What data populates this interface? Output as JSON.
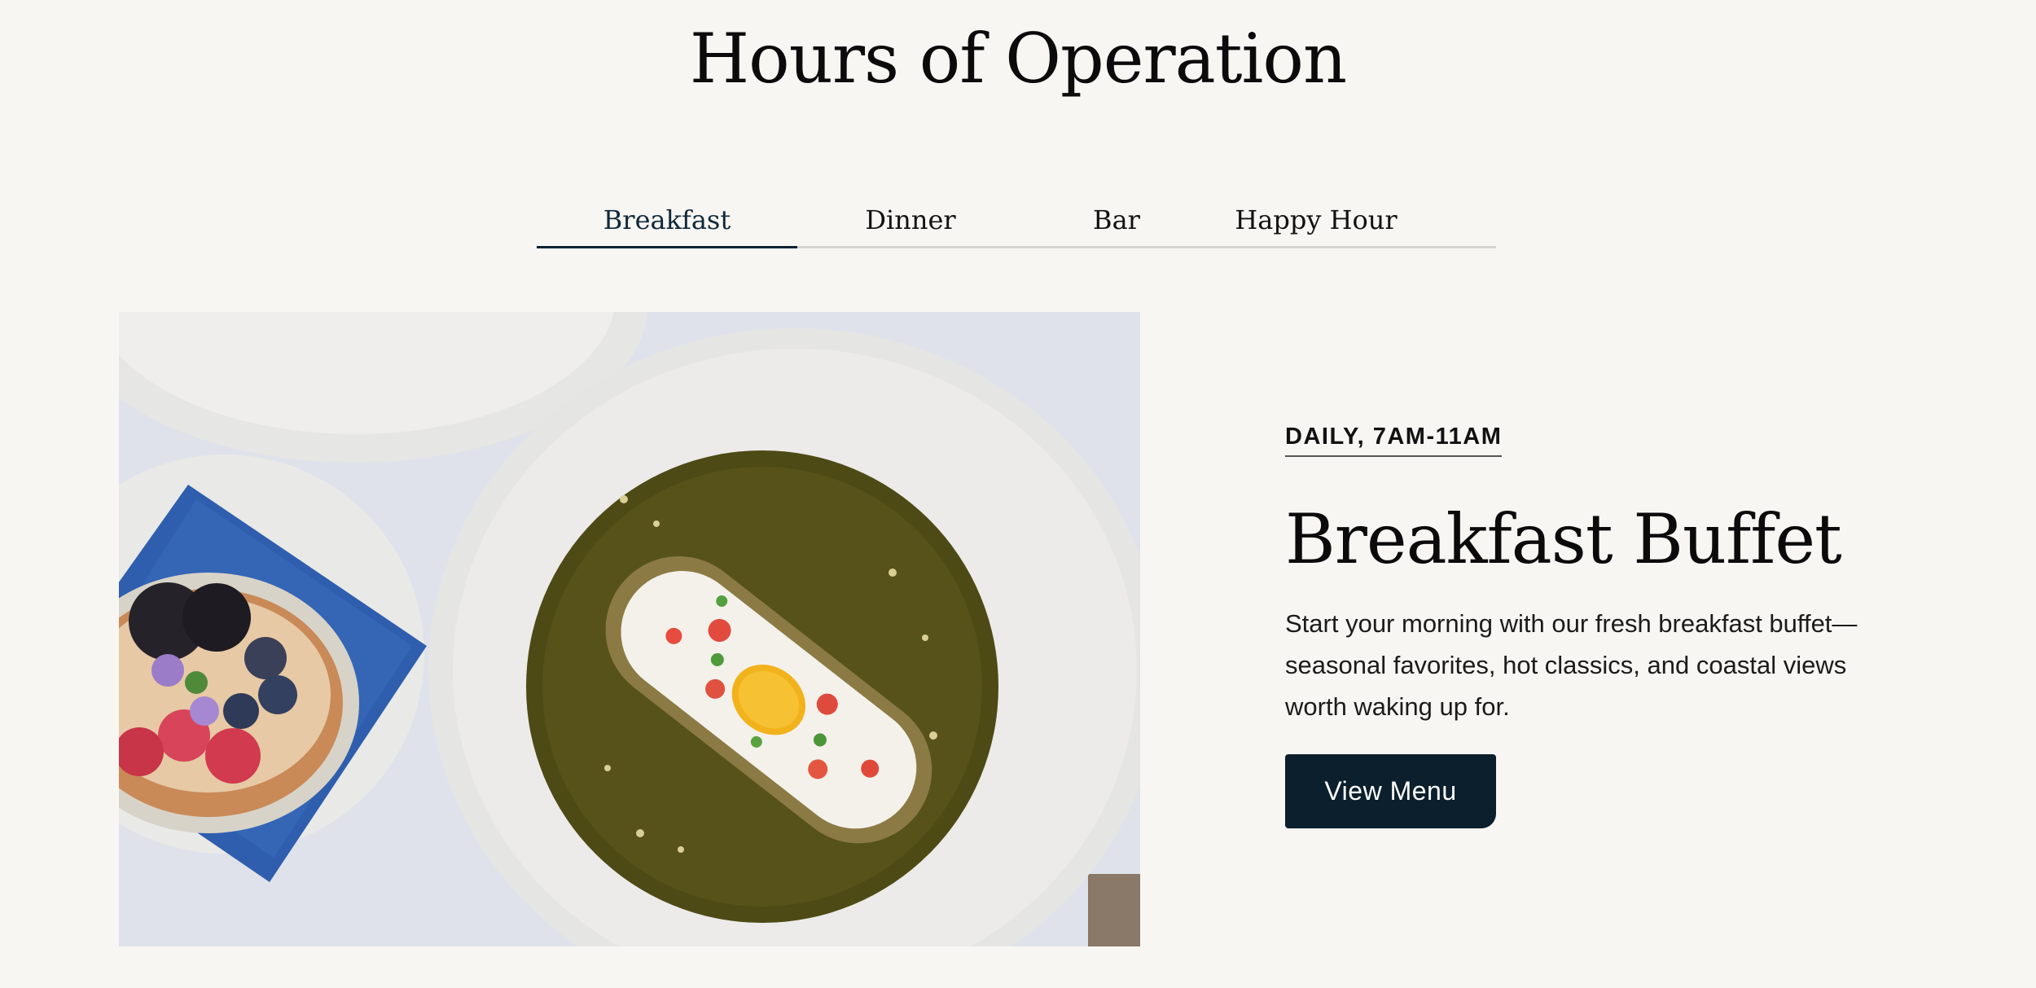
{
  "header": {
    "title": "Hours of Operation"
  },
  "tabs": [
    {
      "label": "Breakfast",
      "active": true
    },
    {
      "label": "Dinner",
      "active": false
    },
    {
      "label": "Bar",
      "active": false
    },
    {
      "label": "Happy Hour",
      "active": false
    }
  ],
  "feature": {
    "hours": "DAILY, 7AM-11AM",
    "heading": "Breakfast Buffet",
    "description": "Start your morning with our fresh breakfast buffet—seasonal favorites, hot classics, and coastal views worth waking up for.",
    "cta_label": "View Menu"
  },
  "colors": {
    "background": "#f7f6f2",
    "accent": "#0b1f2c",
    "tab_underline": "#d6d4cf"
  }
}
